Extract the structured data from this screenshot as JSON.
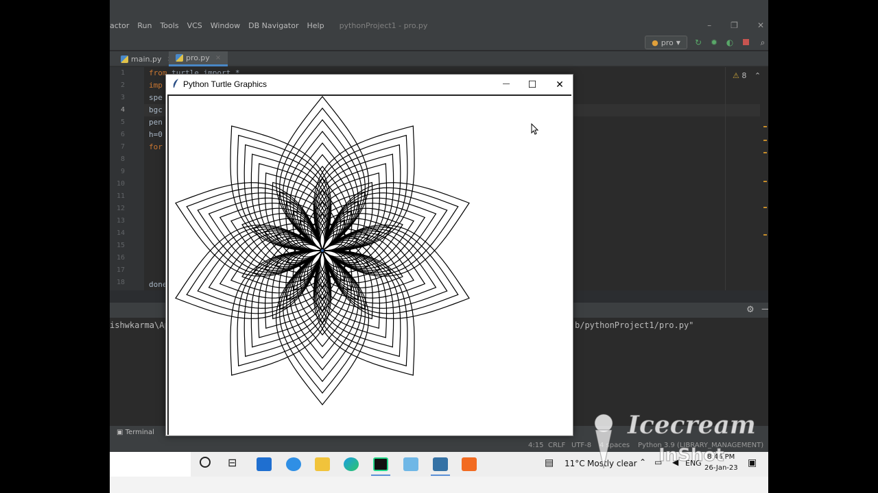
{
  "ide": {
    "menu": [
      "actor",
      "Run",
      "Tools",
      "VCS",
      "Window",
      "DB Navigator",
      "Help"
    ],
    "window_title": "pythonProject1 - pro.py",
    "win_controls": [
      "–",
      "❐",
      "✕"
    ],
    "run_config": "pro",
    "tabs": [
      {
        "label": "main.py",
        "close": "×"
      },
      {
        "label": "pro.py",
        "close": "×"
      }
    ],
    "warnings": "8",
    "line_numbers": [
      "1",
      "2",
      "3",
      "4",
      "5",
      "6",
      "7",
      "8",
      "9",
      "10",
      "11",
      "12",
      "13",
      "14",
      "15",
      "16",
      "17",
      "18"
    ],
    "code_lines": [
      {
        "kw": "from",
        "rest": " turtle import *"
      },
      {
        "kw": "imp",
        "rest": ""
      },
      {
        "kw": "",
        "rest": "spe"
      },
      {
        "kw": "",
        "rest": "bgc"
      },
      {
        "kw": "",
        "rest": "pen"
      },
      {
        "kw": "",
        "rest": "h=0"
      },
      {
        "kw": "for",
        "rest": ""
      }
    ],
    "code_last": "done",
    "run_output_left": "ishwkarma\\Ap",
    "run_output_right": "b/pythonProject1/pro.py\"",
    "terminal_tab": "Terminal",
    "status": {
      "position": "4:15",
      "line_sep": "CRLF",
      "encoding": "UTF-8",
      "indent": "4 spaces",
      "interpreter": "Python 3.9 (LIBRARY_MANAGEMENT)"
    }
  },
  "turtle_window": {
    "title": "Python Turtle Graphics",
    "minimize": "—",
    "maximize": "☐",
    "close": "✕",
    "drawing": {
      "petals": 10,
      "nested_outlines_per_petal": 11,
      "stroke_color": "#000000",
      "background": "#ffffff"
    }
  },
  "taskbar": {
    "weather_temp": "11°C",
    "weather_text": "Mostly clear",
    "language": "ENG",
    "time": "8:46 PM",
    "date": "26-Jan-23"
  },
  "watermark": {
    "line1": "Icecream",
    "line2": "InShot"
  },
  "colors": {
    "ide_bg": "#2b2b2b",
    "ide_panel": "#3c3f41",
    "keyword": "#cc7832",
    "code_text": "#a9b7c6",
    "taskbar": "#eeeeee",
    "accent": "#4a88c7"
  }
}
